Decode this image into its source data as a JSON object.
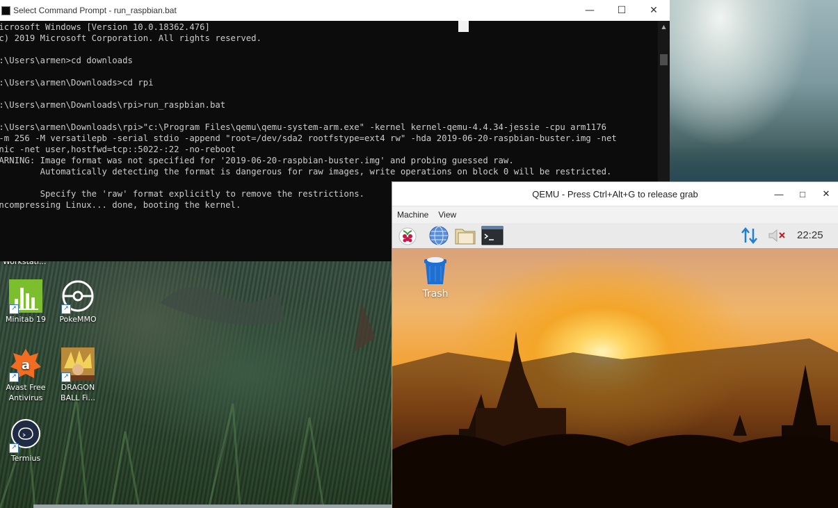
{
  "cmd_window": {
    "title": "Select Command Prompt - run_raspbian.bat",
    "minimize": "—",
    "maximize": "☐",
    "close": "✕",
    "output": "Microsoft Windows [Version 10.0.18362.476]\n(c) 2019 Microsoft Corporation. All rights reserved.\n\nC:\\Users\\armen>cd downloads\n\nC:\\Users\\armen\\Downloads>cd rpi\n\nC:\\Users\\armen\\Downloads\\rpi>run_raspbian.bat\n\nC:\\Users\\armen\\Downloads\\rpi>\"c:\\Program Files\\qemu\\qemu-system-arm.exe\" -kernel kernel-qemu-4.4.34-jessie -cpu arm1176\n -m 256 -M versatilepb -serial stdio -append \"root=/dev/sda2 rootfstype=ext4 rw\" -hda 2019-06-20-raspbian-buster.img -net\n nic -net user,hostfwd=tcp::5022-:22 -no-reboot\nWARNING: Image format was not specified for '2019-06-20-raspbian-buster.img' and probing guessed raw.\n         Automatically detecting the format is dangerous for raw images, write operations on block 0 will be restricted.\n\n         Specify the 'raw' format explicitly to remove the restrictions.\nUncompressing Linux... done, booting the kernel."
  },
  "desktop_icons": {
    "partial_label": "Workstati...",
    "minitab": "Minitab 19",
    "pokemmo": "PokeMMO",
    "avast": "Avast Free Antivirus",
    "dragonball": "DRAGON BALL Fi...",
    "termius": "Termius"
  },
  "qemu_window": {
    "title": "QEMU - Press Ctrl+Alt+G to release grab",
    "minimize": "—",
    "maximize": "□",
    "close": "✕",
    "menu": [
      "Machine",
      "View"
    ],
    "clock": "22:25",
    "trash_label": "Trash"
  },
  "colors": {
    "console_bg": "#0c0c0c",
    "console_text": "#cccccc",
    "panel_bg": "#eaeaea",
    "network_arrows": "#1e7fd6",
    "trash_blue": "#1e6fd0"
  },
  "icons": [
    "raspberry-menu-icon",
    "web-browser-icon",
    "file-manager-icon",
    "terminal-icon",
    "network-icon",
    "volume-muted-icon",
    "trash-icon"
  ]
}
